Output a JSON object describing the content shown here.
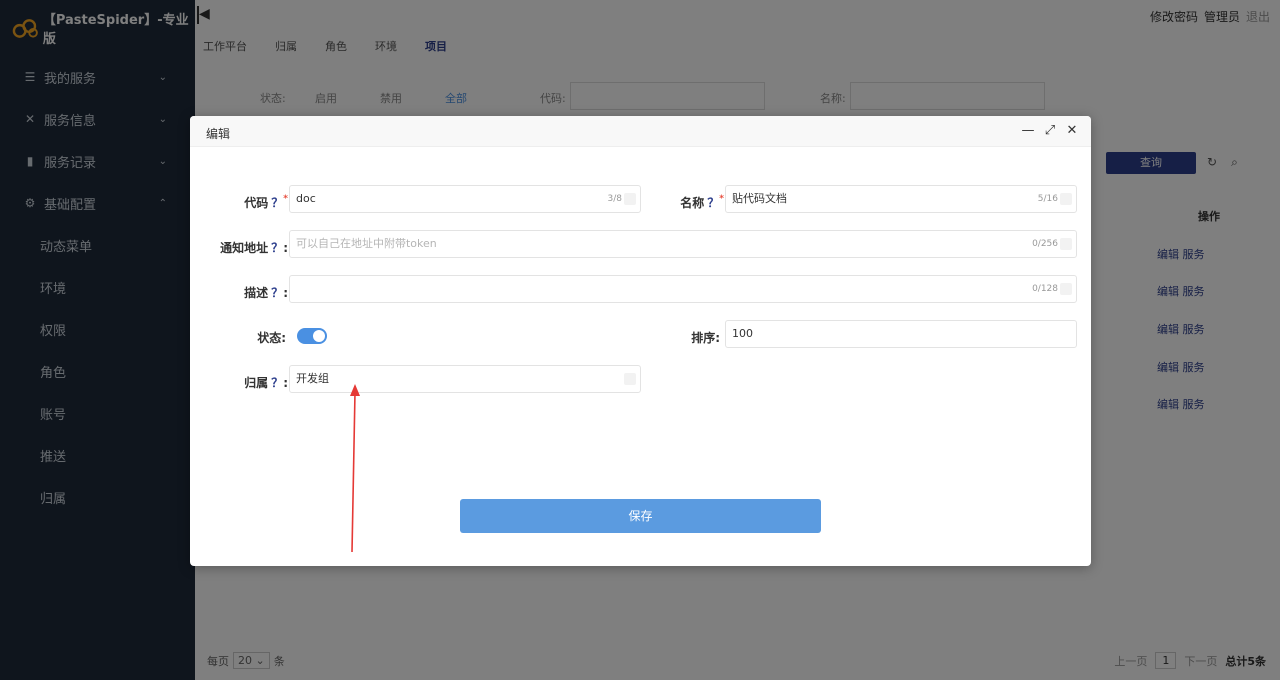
{
  "app": {
    "brand": "【PasteSpider】-专业版"
  },
  "sidebar": {
    "items": [
      {
        "label": "我的服务",
        "icon": "list-icon"
      },
      {
        "label": "服务信息",
        "icon": "tools-icon"
      },
      {
        "label": "服务记录",
        "icon": "file-icon"
      },
      {
        "label": "基础配置",
        "icon": "gear-icon"
      }
    ],
    "sub_items": [
      "动态菜单",
      "环境",
      "权限",
      "角色",
      "账号",
      "推送",
      "归属"
    ]
  },
  "header": {
    "change_password": "修改密码",
    "admin": "管理员",
    "logout": "退出"
  },
  "tabs": [
    "工作平台",
    "归属",
    "角色",
    "环境",
    "项目"
  ],
  "filter": {
    "status_label": "状态:",
    "options": [
      "启用",
      "禁用",
      "全部"
    ],
    "code_label": "代码:",
    "name_label": "名称:"
  },
  "toolbar": {
    "query": "查询"
  },
  "table": {
    "action_header": "操作",
    "rows": [
      {
        "edit": "编辑",
        "service": "服务"
      },
      {
        "edit": "编辑",
        "service": "服务"
      },
      {
        "edit": "编辑",
        "service": "服务"
      },
      {
        "edit": "编辑",
        "service": "服务"
      },
      {
        "edit": "编辑",
        "service": "服务"
      }
    ]
  },
  "pager": {
    "per_page": "每页",
    "size": "20",
    "unit": "条",
    "prev": "上一页",
    "page": "1",
    "next": "下一页",
    "total": "总计5条"
  },
  "modal": {
    "title": "编辑",
    "fields": {
      "code": {
        "label": "代码",
        "value": "doc",
        "count": "3/8"
      },
      "name": {
        "label": "名称",
        "value": "贴代码文档",
        "count": "5/16"
      },
      "notify": {
        "label": "通知地址",
        "placeholder": "可以自己在地址中附带token",
        "count": "0/256"
      },
      "desc": {
        "label": "描述",
        "count": "0/128"
      },
      "status": {
        "label": "状态:",
        "on": true
      },
      "sort": {
        "label": "排序:",
        "value": "100"
      },
      "owner": {
        "label": "归属",
        "value": "开发组"
      }
    },
    "save": "保存",
    "q": "？",
    "colon": ":",
    "req": "*"
  },
  "colors": {
    "sidebar_bg": "#1e2a3a",
    "accent": "#2c3e8c",
    "toggle_on": "#4a90e2",
    "save_button": "#5b9be0",
    "annotation_arrow": "#e53935"
  }
}
